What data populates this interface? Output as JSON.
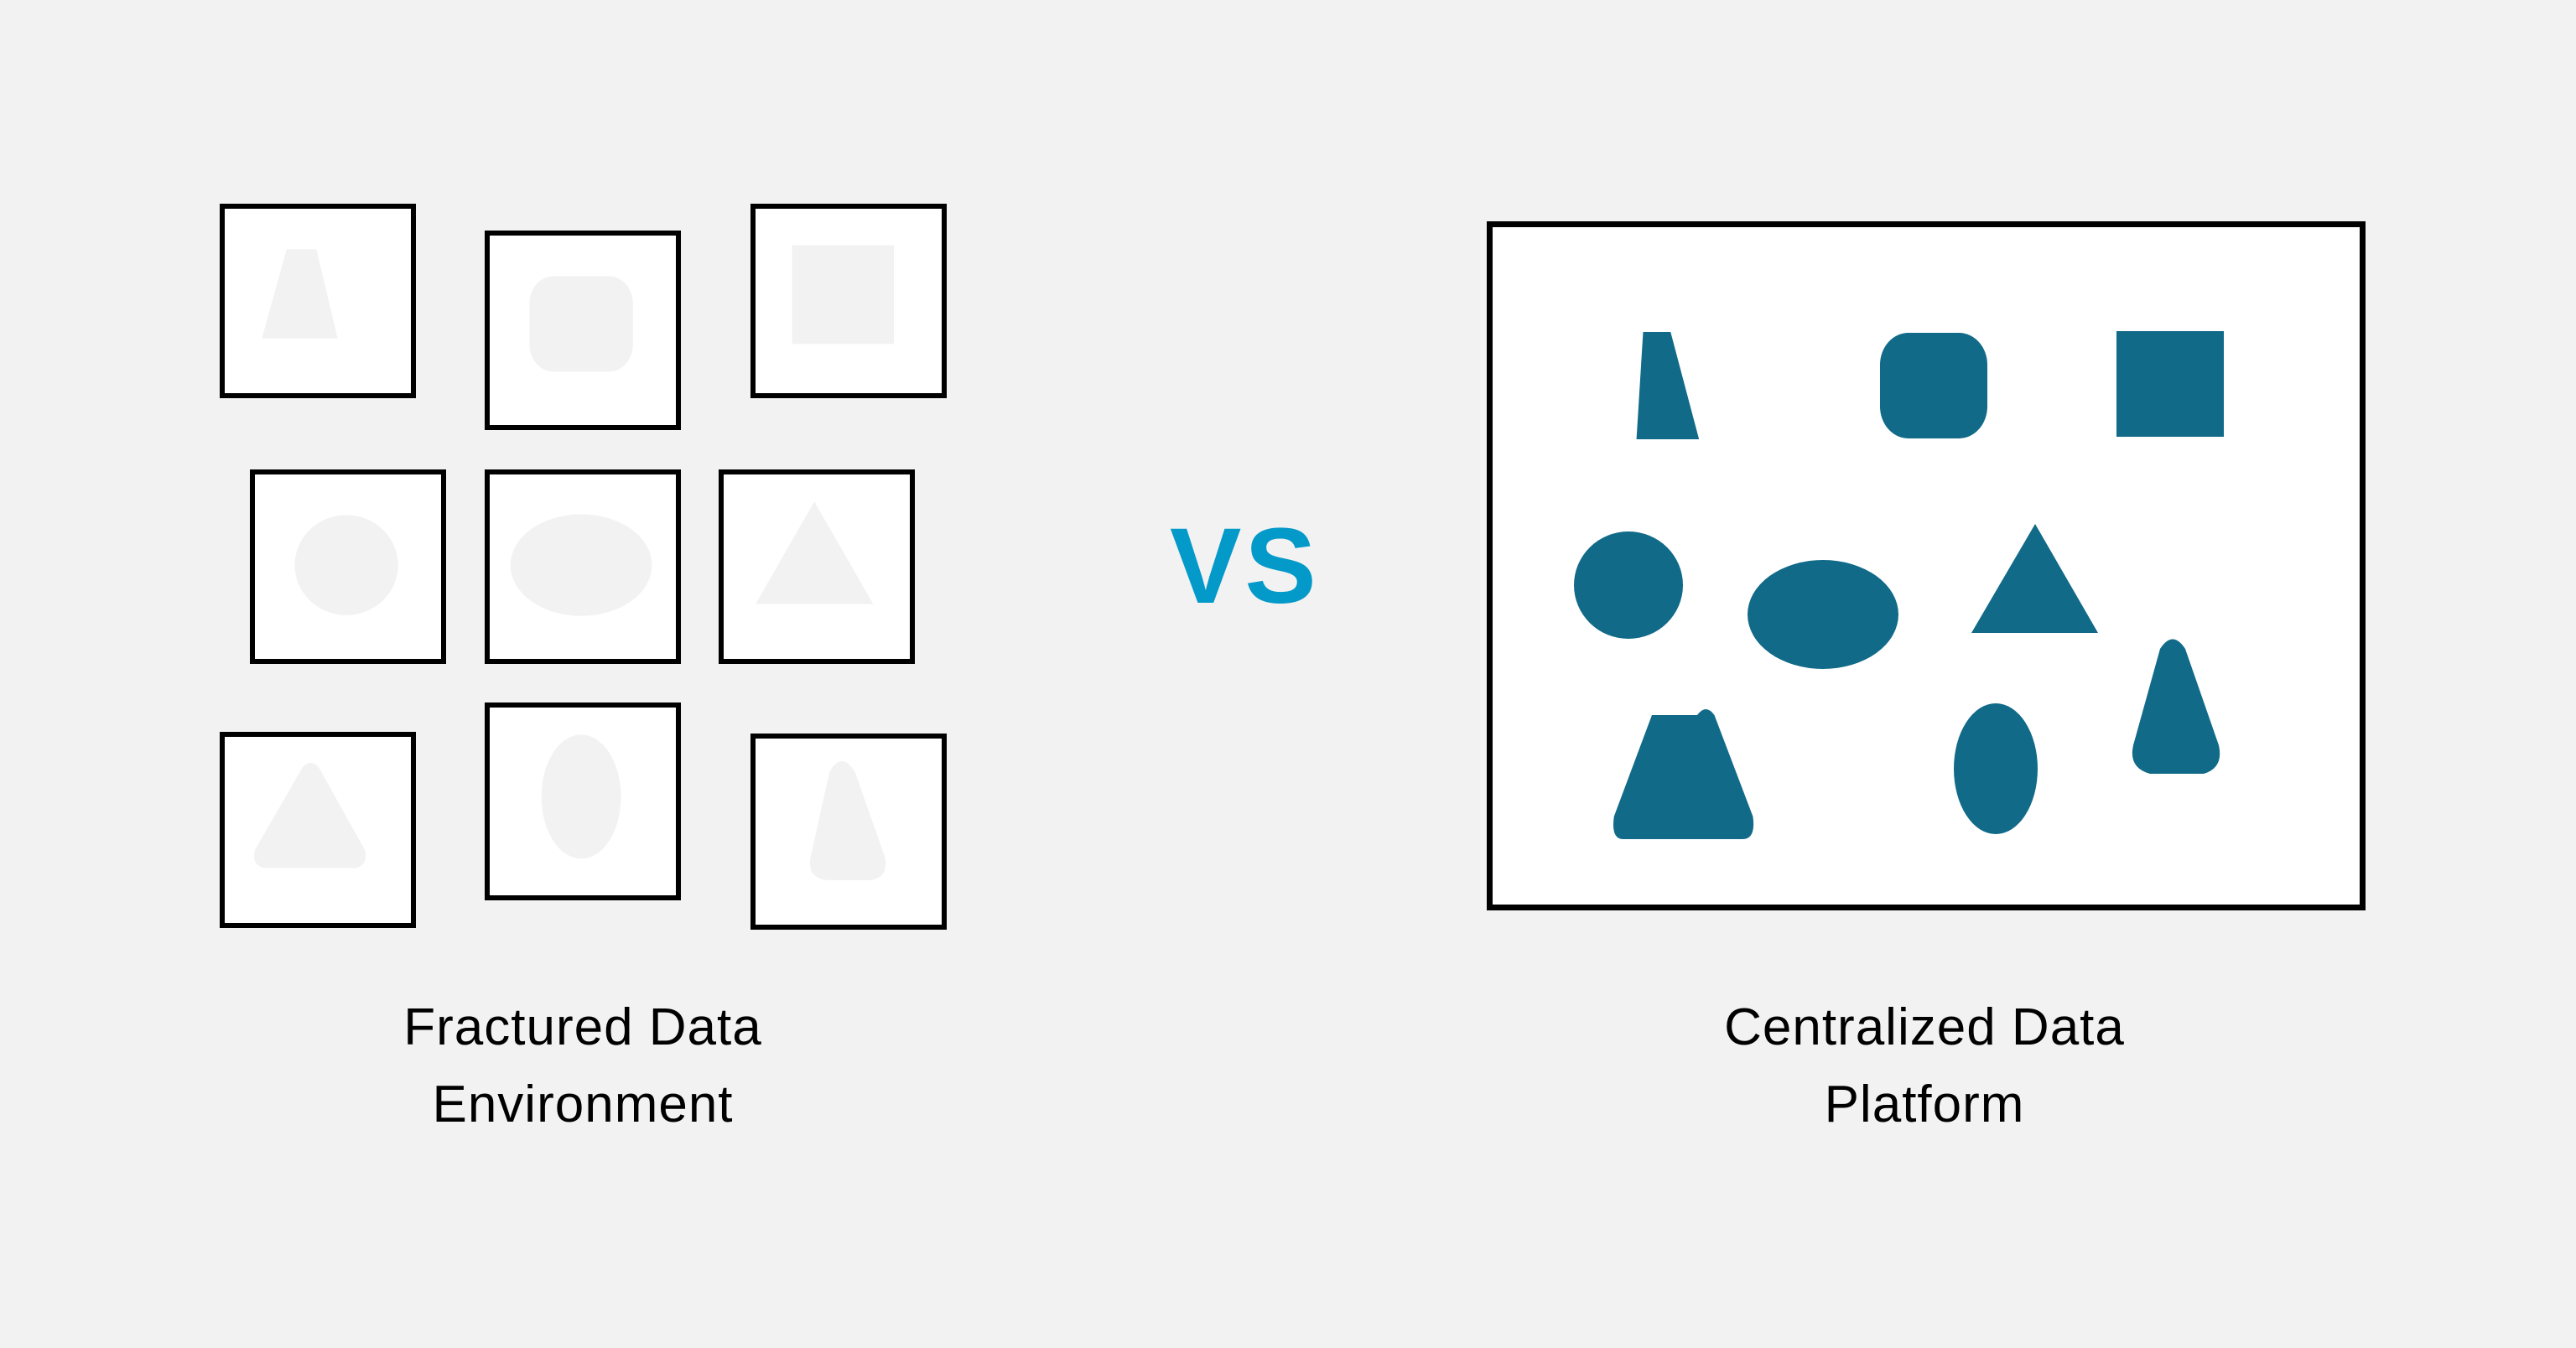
{
  "left_panel": {
    "caption_line1": "Fractured Data",
    "caption_line2": "Environment",
    "shape_fill": "#f2f2f2",
    "boxes": [
      {
        "shape": "trapezoid"
      },
      {
        "shape": "rounded-square"
      },
      {
        "shape": "square"
      },
      {
        "shape": "circle"
      },
      {
        "shape": "ellipse-horizontal"
      },
      {
        "shape": "triangle"
      },
      {
        "shape": "rounded-triangle"
      },
      {
        "shape": "ellipse-vertical"
      },
      {
        "shape": "rounded-trapezoid"
      }
    ]
  },
  "vs_label": "VS",
  "right_panel": {
    "caption_line1": "Centralized Data",
    "caption_line2": "Platform",
    "shape_fill": "#116a88",
    "shapes": [
      "trapezoid",
      "rounded-square",
      "square",
      "circle",
      "ellipse-horizontal",
      "triangle",
      "rounded-triangle",
      "ellipse-vertical",
      "rounded-trapezoid"
    ]
  },
  "colors": {
    "background": "#f2f2f2",
    "vs_accent": "#0399c9",
    "platform_shape": "#116a88",
    "border": "#000000"
  }
}
